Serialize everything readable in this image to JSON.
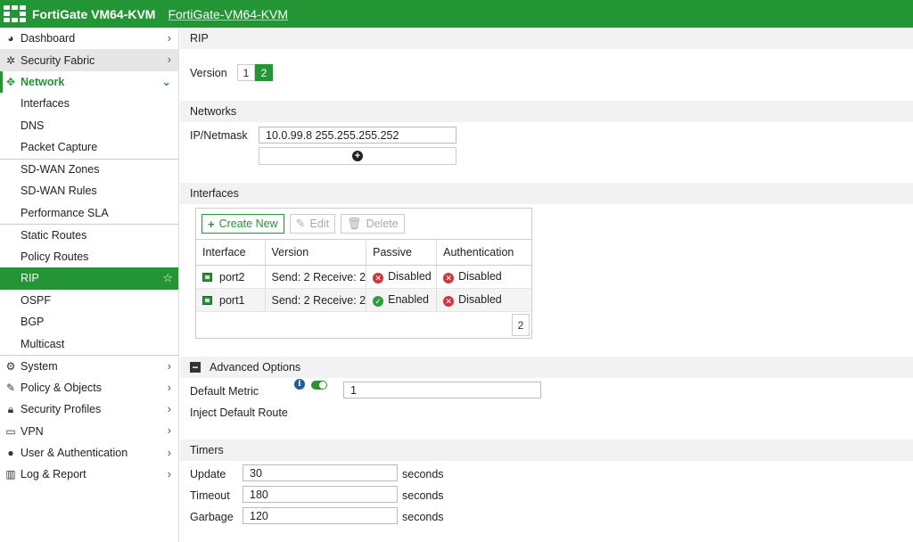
{
  "header": {
    "app_title": "FortiGate VM64-KVM",
    "host_name": "FortiGate-VM64-KVM"
  },
  "sidebar": {
    "items": [
      {
        "label": "Dashboard",
        "icon": "dashboard-icon"
      },
      {
        "label": "Security Fabric",
        "icon": "security-fabric-icon"
      },
      {
        "label": "Network",
        "icon": "network-icon"
      },
      {
        "label": "System",
        "icon": "gear-icon"
      },
      {
        "label": "Policy & Objects",
        "icon": "policy-icon"
      },
      {
        "label": "Security Profiles",
        "icon": "lock-icon"
      },
      {
        "label": "VPN",
        "icon": "laptop-icon"
      },
      {
        "label": "User & Authentication",
        "icon": "user-icon"
      },
      {
        "label": "Log & Report",
        "icon": "chart-icon"
      }
    ],
    "network_sub": [
      "Interfaces",
      "DNS",
      "Packet Capture",
      "SD-WAN Zones",
      "SD-WAN Rules",
      "Performance SLA",
      "Static Routes",
      "Policy Routes",
      "RIP",
      "OSPF",
      "BGP",
      "Multicast"
    ]
  },
  "rip": {
    "title": "RIP",
    "version_label": "Version",
    "versions": [
      "1",
      "2"
    ],
    "selected_version": "2",
    "networks_title": "Networks",
    "ip_netmask_label": "IP/Netmask",
    "ip_netmask_value": "10.0.99.8 255.255.255.252",
    "interfaces_title": "Interfaces",
    "toolbar": {
      "create_new": "Create New",
      "edit": "Edit",
      "delete": "Delete"
    },
    "columns": [
      "Interface",
      "Version",
      "Passive",
      "Authentication"
    ],
    "rows": [
      {
        "interface": "port2",
        "version": "Send: 2 Receive: 2",
        "passive": "Disabled",
        "authentication": "Disabled"
      },
      {
        "interface": "port1",
        "version": "Send: 2 Receive: 2",
        "passive": "Enabled",
        "authentication": "Disabled"
      }
    ],
    "row_count": "2",
    "advanced_title": "Advanced Options",
    "default_metric_label": "Default Metric",
    "default_metric_value": "1",
    "inject_label": "Inject Default Route",
    "inject_enabled": true,
    "timers_title": "Timers",
    "timers": [
      {
        "label": "Update",
        "value": "30",
        "unit": "seconds"
      },
      {
        "label": "Timeout",
        "value": "180",
        "unit": "seconds"
      },
      {
        "label": "Garbage",
        "value": "120",
        "unit": "seconds"
      }
    ]
  },
  "colors": {
    "brand": "#239535",
    "error": "#d0353b",
    "info": "#1c5d9e"
  }
}
